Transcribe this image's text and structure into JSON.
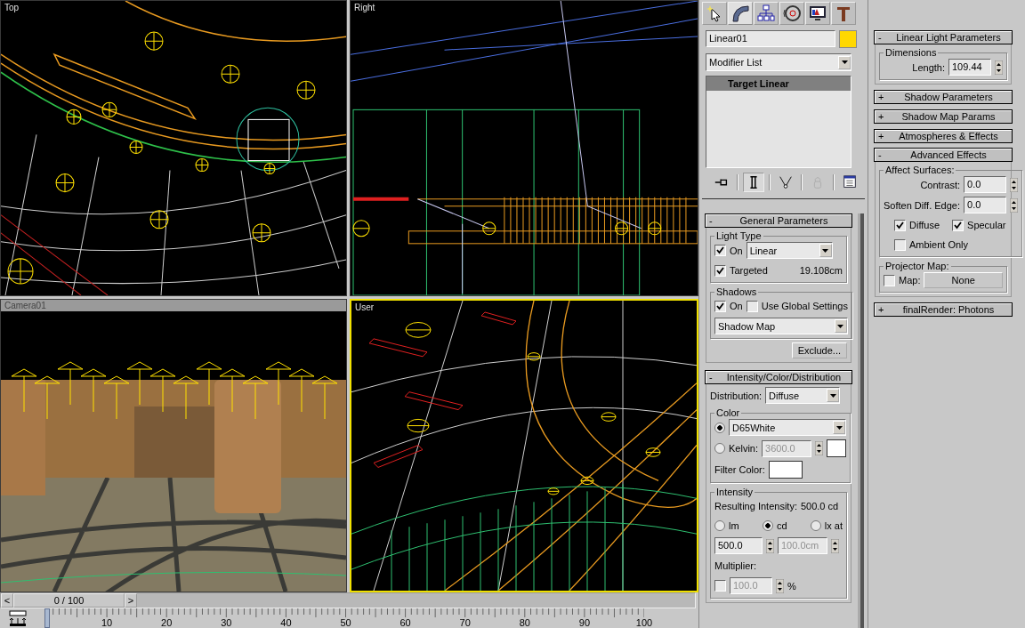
{
  "viewports": [
    {
      "label": "Top",
      "kind": "top",
      "selected": false
    },
    {
      "label": "Right",
      "kind": "side",
      "selected": false
    },
    {
      "label": "Camera01",
      "kind": "camera",
      "selected": false
    },
    {
      "label": "User",
      "kind": "user",
      "selected": true
    }
  ],
  "time_slider": {
    "prev": "<",
    "position": "0 / 100",
    "next": ">"
  },
  "track_bar": {
    "labels": [
      "10",
      "20",
      "30",
      "40",
      "50",
      "60",
      "70",
      "80",
      "90",
      "100"
    ]
  },
  "command_panel": {
    "tabs": [
      {
        "selected": false
      },
      {
        "selected": true
      },
      {
        "selected": false
      },
      {
        "selected": false
      },
      {
        "selected": false
      },
      {
        "selected": false
      }
    ],
    "object_name": "Linear01",
    "modifier_list": "Modifier List",
    "stack": [
      {
        "label": "Target Linear",
        "selected": true
      }
    ],
    "stack_tools": [
      {
        "on": false,
        "disabled": false
      },
      {
        "on": true,
        "disabled": false
      },
      {
        "on": false,
        "disabled": false
      },
      {
        "on": false,
        "disabled": true
      },
      {
        "on": false,
        "disabled": false
      }
    ]
  },
  "general_parameters": {
    "sign": "-",
    "title": "General Parameters",
    "light_type": {
      "caption": "Light Type",
      "on": {
        "label": "On",
        "checked": true
      },
      "type": "Linear",
      "targeted": {
        "label": "Targeted",
        "checked": true
      },
      "distance": "19.108cm"
    },
    "shadows": {
      "caption": "Shadows",
      "on": {
        "label": "On",
        "checked": true
      },
      "use_global": {
        "label": "Use Global Settings",
        "checked": false
      },
      "type": "Shadow Map",
      "exclude": "Exclude..."
    }
  },
  "intensity_color_distribution": {
    "sign": "-",
    "title": "Intensity/Color/Distribution",
    "distribution_label": "Distribution:",
    "distribution": "Diffuse",
    "color": {
      "caption": "Color",
      "preset": {
        "selected": true,
        "value": "D65White"
      },
      "kelvin": {
        "selected": false,
        "label": "Kelvin:",
        "value": "3600.0",
        "disabled": true
      },
      "filter_label": "Filter Color:"
    },
    "intensity": {
      "caption": "Intensity",
      "resulting_label": "Resulting Intensity:",
      "resulting": "500.0 cd",
      "units": [
        {
          "label": "lm",
          "selected": false
        },
        {
          "label": "cd",
          "selected": true
        },
        {
          "label": "lx at",
          "selected": false
        }
      ],
      "value": "500.0",
      "distance": {
        "value": "100.0cm",
        "disabled": true
      },
      "multiplier_label": "Multiplier:",
      "multiplier": {
        "checked": false,
        "value": "100.0",
        "disabled": true,
        "unit": "%"
      }
    }
  },
  "linear_light_parameters": {
    "sign": "-",
    "title": "Linear Light Parameters",
    "caption": "Dimensions",
    "length_label": "Length:",
    "length": "109.44"
  },
  "collapsed_rollouts": [
    {
      "sign": "+",
      "title": "Shadow Parameters"
    },
    {
      "sign": "+",
      "title": "Shadow Map Params"
    },
    {
      "sign": "+",
      "title": "Atmospheres & Effects"
    }
  ],
  "advanced_effects": {
    "sign": "-",
    "title": "Advanced Effects",
    "caption": "Affect Surfaces:",
    "contrast_label": "Contrast:",
    "contrast": "0.0",
    "soften_label": "Soften Diff. Edge:",
    "soften": "0.0",
    "diffuse": {
      "label": "Diffuse",
      "checked": true
    },
    "specular": {
      "label": "Specular",
      "checked": true
    },
    "ambient_only": {
      "label": "Ambient Only",
      "checked": false
    },
    "projector": {
      "caption": "Projector Map:",
      "map": {
        "label": "Map:",
        "checked": false
      },
      "button": "None"
    }
  },
  "final_render": {
    "sign": "+",
    "title": "finalRender: Photons"
  }
}
